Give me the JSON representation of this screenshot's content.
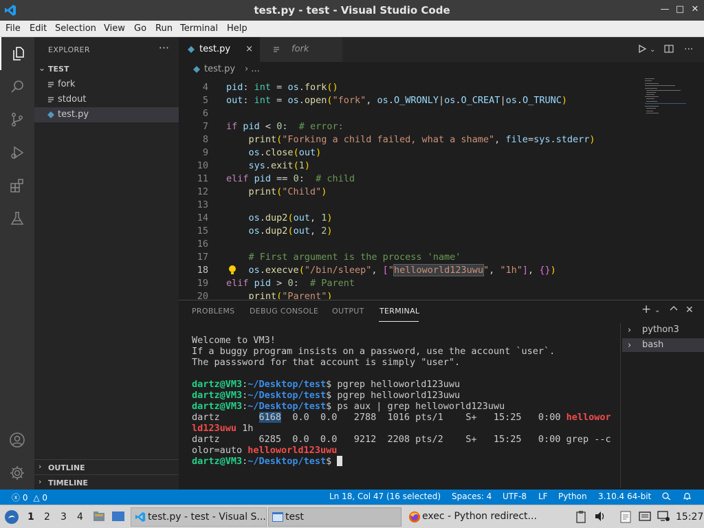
{
  "window": {
    "title": "test.py - test - Visual Studio Code",
    "controls": [
      "minimize",
      "maximize",
      "close"
    ]
  },
  "menu": [
    "File",
    "Edit",
    "Selection",
    "View",
    "Go",
    "Run",
    "Terminal",
    "Help"
  ],
  "activity_bar": {
    "items": [
      "explorer-icon",
      "search-icon",
      "source-control-icon",
      "run-debug-icon",
      "extensions-icon",
      "testing-icon"
    ],
    "bottom": [
      "accounts-icon",
      "manage-gear-icon"
    ]
  },
  "sidebar": {
    "title": "EXPLORER",
    "more": "···",
    "folder": "TEST",
    "files": [
      {
        "name": "fork",
        "icon": "file-lines-icon"
      },
      {
        "name": "stdout",
        "icon": "file-lines-icon"
      },
      {
        "name": "test.py",
        "icon": "python-icon"
      }
    ],
    "sections": [
      "OUTLINE",
      "TIMELINE"
    ]
  },
  "editor": {
    "tabs": [
      {
        "label": "test.py",
        "close": "×"
      },
      {
        "label": "fork"
      }
    ],
    "breadcrumb": {
      "file": "test.py",
      "sep": "›",
      "rest": "..."
    },
    "line_numbers": [
      "4",
      "5",
      "6",
      "7",
      "8",
      "9",
      "10",
      "11",
      "12",
      "13",
      "14",
      "15",
      "16",
      "17",
      "18",
      "19",
      "20"
    ],
    "current_line": "18"
  },
  "panel": {
    "tabs": [
      "PROBLEMS",
      "DEBUG CONSOLE",
      "OUTPUT",
      "TERMINAL"
    ],
    "active_tab": "TERMINAL",
    "terminal": {
      "welcome": [
        "Welcome to VM3!",
        "If a buggy program insists on a password, use the account `user`.",
        "The passsword for that account is simply \"user\"."
      ],
      "prompt_user": "dartz@VM3",
      "prompt_sep": ":",
      "prompt_path": "~/Desktop/test",
      "prompt_end": "$ ",
      "commands": [
        "pgrep helloworld123uwu",
        "pgrep helloworld123uwu",
        "ps aux | grep helloworld123uwu"
      ],
      "ps_row1_user": "dartz",
      "ps_row1_pid": "6168",
      "ps_row1_rest": "  0.0  0.0   2788  1016 pts/1    S+   15:25   0:00 ",
      "ps_row1_match_a": "hellowor",
      "ps_row1_match_b": "ld123uwu",
      "ps_row1_tail": " 1h",
      "ps_row2_pre": "dartz       6285  0.0  0.0   9212  2208 pts/2    S+   15:25   0:00 grep --c",
      "ps_row2_cont": "olor=auto ",
      "ps_row2_match": "helloworld123uwu"
    },
    "terminal_list": [
      "python3",
      "bash"
    ]
  },
  "statusbar": {
    "errors": "0",
    "warnings": "0",
    "position": "Ln 18, Col 47 (16 selected)",
    "spaces": "Spaces: 4",
    "encoding": "UTF-8",
    "eol": "LF",
    "language": "Python",
    "interpreter": "3.10.4 64-bit"
  },
  "taskbar": {
    "workspaces": [
      "1",
      "2",
      "3",
      "4"
    ],
    "active_workspace": "1",
    "windows": [
      "test.py - test - Visual S...",
      "test",
      "exec - Python redirect..."
    ],
    "clock": "15:27"
  },
  "colors": {
    "accent": "#007acc",
    "terminal_prompt_user": "#23d18b",
    "terminal_prompt_path": "#3b8eea",
    "grep_match": "#f14c4c"
  }
}
